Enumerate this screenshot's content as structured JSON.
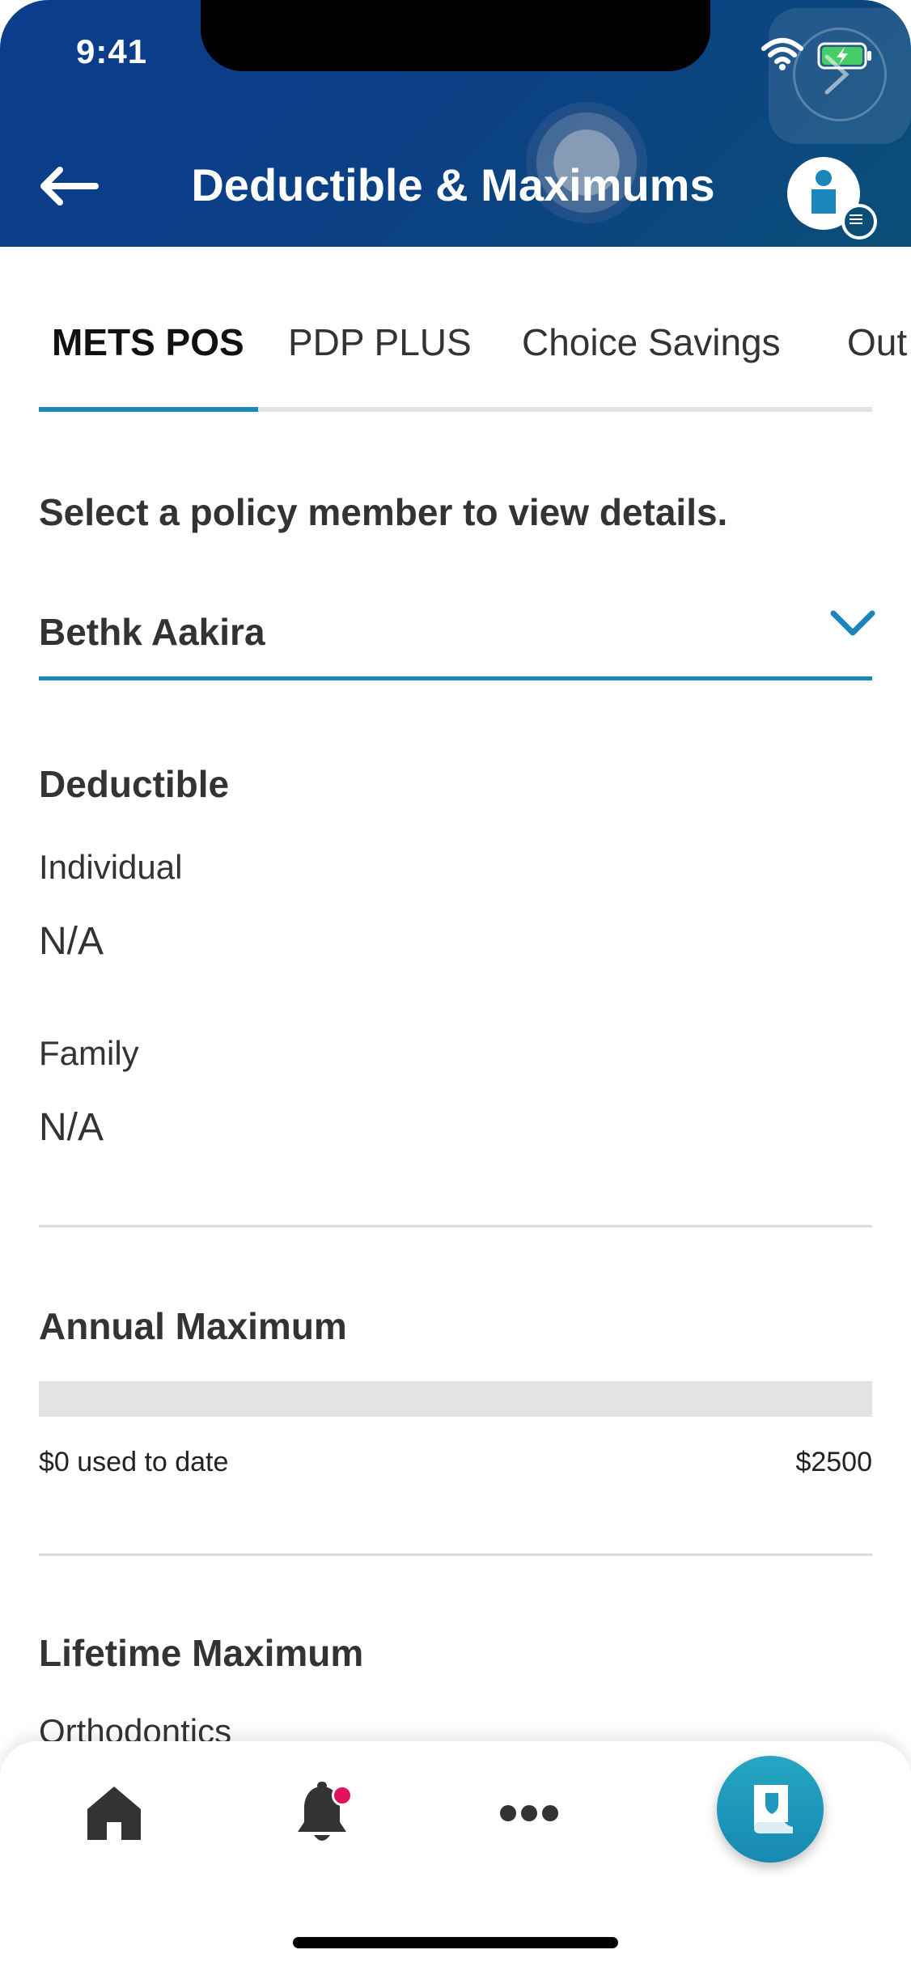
{
  "status_bar": {
    "time": "9:41"
  },
  "header": {
    "title": "Deductible & Maximums"
  },
  "tabs": [
    {
      "label": "METS POS"
    },
    {
      "label": "PDP PLUS"
    },
    {
      "label": "Choice Savings"
    },
    {
      "label": "Out"
    }
  ],
  "member_select": {
    "prompt": "Select a policy member to view details.",
    "selected": "Bethk Aakira"
  },
  "deductible": {
    "title": "Deductible",
    "individual_label": "Individual",
    "individual_value": "N/A",
    "family_label": "Family",
    "family_value": "N/A"
  },
  "annual_maximum": {
    "title": "Annual Maximum",
    "used_text": "$0 used to date",
    "max_text": "$2500",
    "used_amount": 0,
    "max_amount": 2500
  },
  "lifetime_maximum": {
    "title": "Lifetime Maximum",
    "first_label": "Orthodontics"
  },
  "bottom_nav": {
    "items": [
      "home-icon",
      "bell-icon",
      "more-icon",
      "policy-card-icon"
    ]
  },
  "colors": {
    "header_bg": "#0b3f86",
    "accent": "#1b86b9",
    "fab": "#1f98bb",
    "notification_dot": "#e0115f"
  }
}
